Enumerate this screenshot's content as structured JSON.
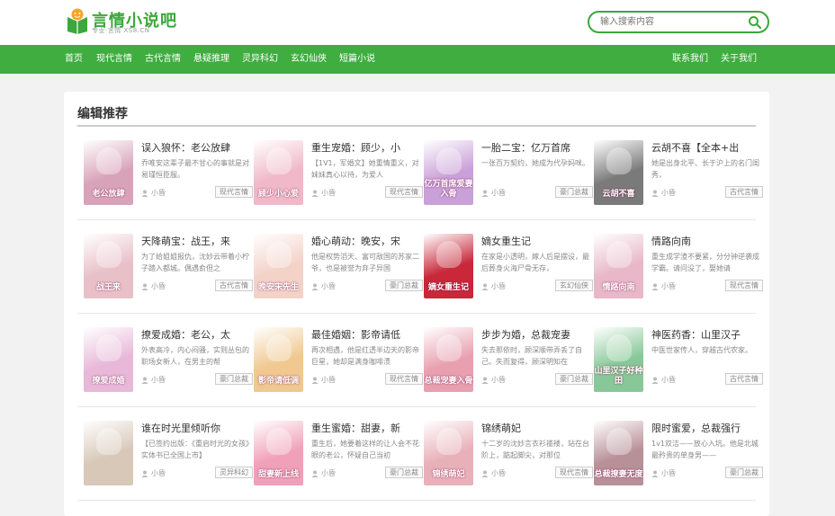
{
  "site": {
    "logo_text": "言情小说吧",
    "logo_sub": "专业·言情 XS8.CN",
    "brand_color": "#3fad3f"
  },
  "search": {
    "placeholder": "输入搜索内容",
    "icon": "search-icon"
  },
  "nav": {
    "left": [
      "首页",
      "现代言情",
      "古代言情",
      "悬疑推理",
      "灵异科幻",
      "玄幻仙侠",
      "短篇小说"
    ],
    "right": [
      "联系我们",
      "关于我们"
    ]
  },
  "section": {
    "title": "编辑推荐"
  },
  "books": [
    {
      "title": "误入狼怀：老公放肆",
      "desc": "乔唯安这辈子最不甘心的事就是对易瑾恒臣服。",
      "author": "小昏",
      "tag": "现代言情",
      "cover_text": "老公放肆",
      "cover_color": "#d8a3b8"
    },
    {
      "title": "重生宠婚：顾少，小",
      "desc": "【1V1，军婚文】她重情重义，对妹妹真心以待，为爱人",
      "author": "小昏",
      "tag": "现代言情",
      "cover_text": "顾少小心爱",
      "cover_color": "#f0b8c8"
    },
    {
      "title": "一胎二宝：亿万首席",
      "desc": "一张百万契约，她成为代孕妈咪。",
      "author": "小昏",
      "tag": "豪门总裁",
      "cover_text": "亿万首席爱妻入骨",
      "cover_color": "#c9a0d8"
    },
    {
      "title": "云胡不喜【全本+出",
      "desc": "她是出身北平、长于沪上的名门闺秀，",
      "author": "小昏",
      "tag": "古代言情",
      "cover_text": "云胡不喜",
      "cover_color": "#7a7a7a"
    },
    {
      "title": "天降萌宝：战王，来",
      "desc": "为了给姐姐报仇，沈妙云带着小柠子踏入都城。偶遇俞但之",
      "author": "小昏",
      "tag": "古代言情",
      "cover_text": "战王来",
      "cover_color": "#e8c0c8"
    },
    {
      "title": "婚心萌动：晚安，宋",
      "desc": "他是权势滔天、富可敌国的苏家二爷，也是被誉为弃子异国",
      "author": "小昏",
      "tag": "豪门总裁",
      "cover_text": "晚安宋先生",
      "cover_color": "#f3d2c8"
    },
    {
      "title": "嫡女重生记",
      "desc": "在家是小透明，嫁人后是摆设，最后葬身火海尸骨无存，",
      "author": "小昏",
      "tag": "玄幻仙侠",
      "cover_text": "嫡女重生记",
      "cover_color": "#c8283a"
    },
    {
      "title": "情路向南",
      "desc": "重生成学渣不要紧，分分钟逆袭成学霸。请问没了，娶她请",
      "author": "小昏",
      "tag": "现代言情",
      "cover_text": "情路向南",
      "cover_color": "#e8b8c8"
    },
    {
      "title": "撩爱成婚：老公，太",
      "desc": "外表高冷，内心闷骚，实则丛包的职场女新人，在男主的帮",
      "author": "小昏",
      "tag": "豪门总裁",
      "cover_text": "撩爱成婚",
      "cover_color": "#e8b8d8"
    },
    {
      "title": "最佳婚姻：影帝请低",
      "desc": "再次相遇，他是红透半边天的影帝巨星，她却是满身咖啡渍",
      "author": "小昏",
      "tag": "现代言情",
      "cover_text": "影帝请低调",
      "cover_color": "#f0c890"
    },
    {
      "title": "步步为婚，总裁宠妻",
      "desc": "失去那依时，顾深顺带弄丢了自己。失而复得，顾深明知在",
      "author": "小昏",
      "tag": "豪门总裁",
      "cover_text": "总裁宠妻入骨",
      "cover_color": "#e8a0b0"
    },
    {
      "title": "神医药香：山里汉子",
      "desc": "中医世家传人，穿越古代农家。",
      "author": "小昏",
      "tag": "古代言情",
      "cover_text": "山里汉子好种田",
      "cover_color": "#88c898"
    },
    {
      "title": "谁在时光里倾听你",
      "desc": "【已签约出版：《重启时光的女孩》实体书已全国上市】",
      "author": "小昏",
      "tag": "灵异科幻",
      "cover_text": "",
      "cover_color": "#d8c8b8"
    },
    {
      "title": "重生蜜婚：甜妻，新",
      "desc": "重生后，她要着这样的让人会不花眼的老公，怀疑自己当初",
      "author": "小昏",
      "tag": "豪门总裁",
      "cover_text": "甜妻新上线",
      "cover_color": "#f0a0b8"
    },
    {
      "title": "锦绣萌妃",
      "desc": "十二岁的沈妙言衣衫褴褛，站在台阶上，踮起脚尖，对那位",
      "author": "小昏",
      "tag": "现代言情",
      "cover_text": "锦绣萌妃",
      "cover_color": "#e8b0b8"
    },
    {
      "title": "限时蜜爱，总裁强行",
      "desc": "1v1双洁——放心入坑。他是北城最矜贵的单身男——",
      "author": "小昏",
      "tag": "豪门总裁",
      "cover_text": "总裁撩妻无度",
      "cover_color": "#b89098"
    }
  ]
}
